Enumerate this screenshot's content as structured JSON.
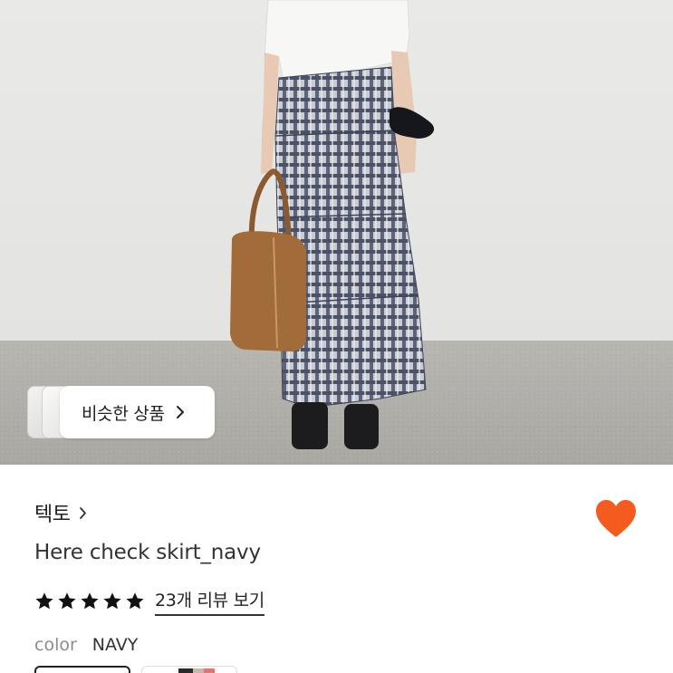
{
  "similar_products": {
    "label": "비슷한 상품",
    "icon": "chevron-right-icon"
  },
  "product": {
    "brand": "텍토",
    "title": "Here check skirt_navy",
    "rating": 5,
    "reviews_link": "23개 리뷰 보기",
    "color_label": "color",
    "color_value": "NAVY"
  },
  "like": {
    "icon": "heart-icon",
    "color": "#F45B1E",
    "active": true
  },
  "colors": {
    "star": "#111111",
    "text": "#222222",
    "muted": "#8C8C8C"
  }
}
